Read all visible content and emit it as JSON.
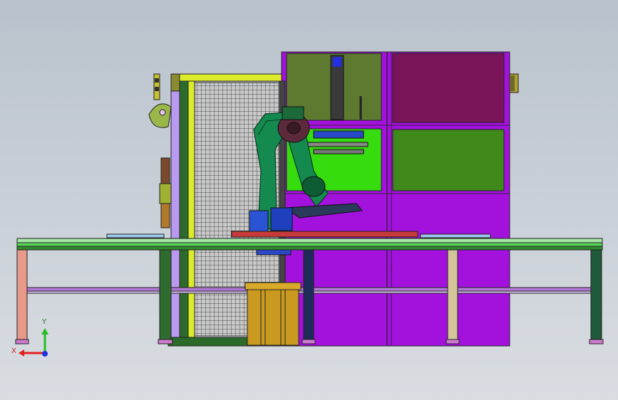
{
  "viewport": {
    "background_top": "#b9c2cc",
    "background_bottom": "#d9dde2"
  },
  "colors": {
    "cabinet": "#a311dd",
    "cabinet_dark": "#7d0d9f",
    "panel_olive": "#5e7a30",
    "panel_maroon": "#7b1559",
    "panel_lime": "#37dc0f",
    "panel_green": "#3f8a1a",
    "robot": "#148a4f",
    "robot_dark": "#0d5c34",
    "robot_joint": "#5c2a3a",
    "frame_yellow": "#dcec2b",
    "frame_green": "#2d6b2d",
    "fence_lavender": "#b99af0",
    "conveyor_rail": "#59d659",
    "conveyor_rail_dark": "#2f8a2f",
    "table_top": "#a6e6a6",
    "red_plate": "#c83a3a",
    "crate": "#c99a1f",
    "leg_salmon": "#e89a8a",
    "leg_green": "#2e6b2e",
    "leg_beige": "#d4c49a",
    "leg_navy": "#1e2a5a",
    "leg_darkgreen": "#1f5a3a",
    "axis_x": "#e0201e",
    "axis_y": "#20c020",
    "axis_origin": "#2030e0"
  },
  "triad": {
    "x_label": "X",
    "y_label": "Y"
  }
}
